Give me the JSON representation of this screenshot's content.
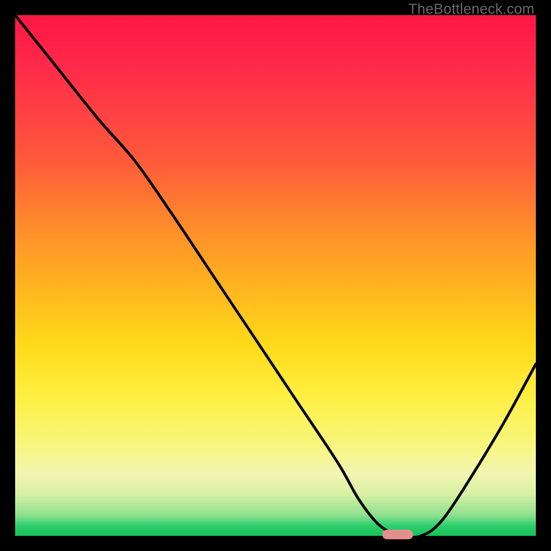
{
  "watermark": "TheBottleneck.com",
  "colors": {
    "background": "#000000",
    "gradient_top": "#ff1744",
    "gradient_mid": "#ffd91a",
    "gradient_bottom": "#16c257",
    "curve": "#000000",
    "marker": "#e38f8f"
  },
  "chart_data": {
    "type": "line",
    "title": "",
    "xlabel": "",
    "ylabel": "",
    "xlim": [
      0,
      100
    ],
    "ylim": [
      0,
      100
    ],
    "grid": false,
    "legend": null,
    "note": "No axis ticks or numeric labels are visible in the image; x/y values below are estimated from pixel positions as a 0–100 percentage of the plot area (y=100 is top).",
    "series": [
      {
        "name": "curve",
        "x": [
          0,
          8,
          16,
          23,
          30,
          38,
          46,
          54,
          62,
          66,
          70,
          74,
          78,
          82,
          88,
          94,
          100
        ],
        "y": [
          100,
          90,
          80,
          72,
          62,
          50,
          38,
          26,
          14,
          7,
          2,
          0,
          0,
          3,
          12,
          22,
          33
        ]
      }
    ],
    "marker": {
      "name": "optimal-range",
      "x_range_pct": [
        70.5,
        76.5
      ],
      "y_pct": 0
    }
  }
}
